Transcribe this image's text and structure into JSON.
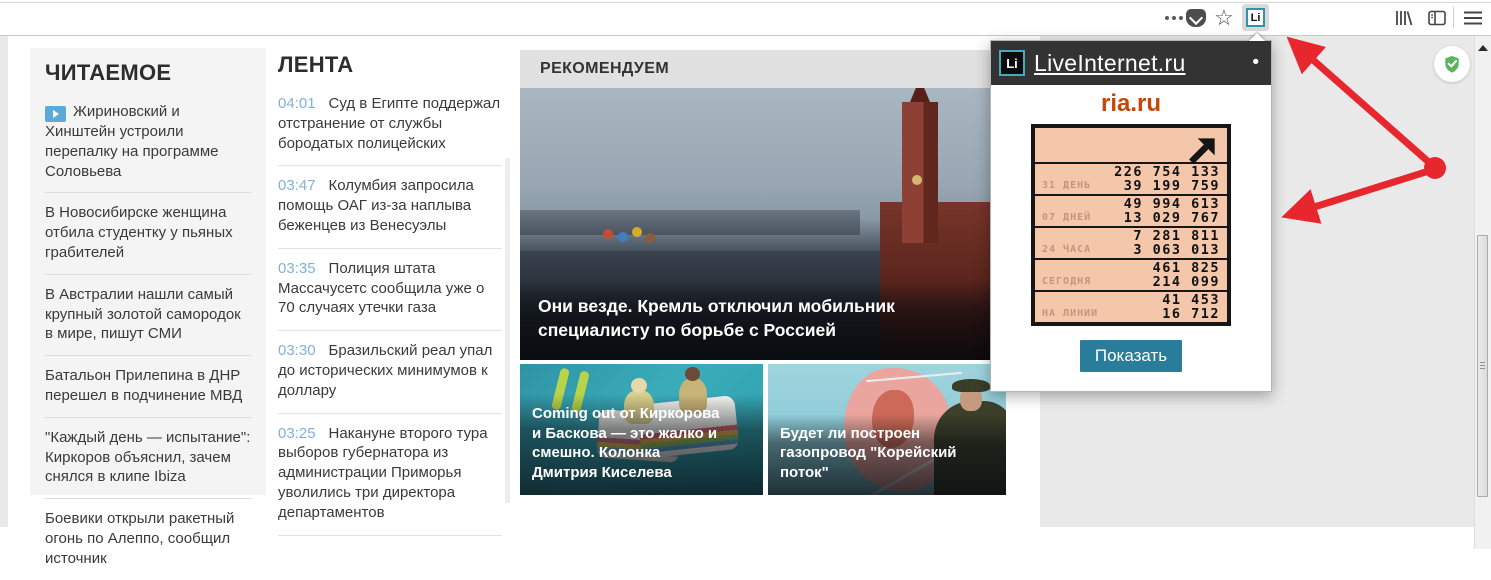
{
  "browser": {
    "li_button": "Li"
  },
  "page": {
    "readable": {
      "title": "ЧИТАЕМОЕ",
      "items": [
        {
          "text": "Жириновский и Хинштейн устроили перепалку на программе Соловьева"
        },
        {
          "text": "В Новосибирске женщина отбила студентку у пьяных грабителей"
        },
        {
          "text": "В Австралии нашли самый крупный золотой самородок в мире, пишут СМИ"
        },
        {
          "text": "Батальон Прилепина в ДНР перешел в подчинение МВД"
        },
        {
          "text": "\"Каждый день — испытание\": Киркоров объяснил, зачем снялся в клипе Ibiza"
        },
        {
          "text": "Боевики открыли ракетный огонь по Алеппо, сообщил источник"
        }
      ]
    },
    "feed": {
      "title": "ЛЕНТА",
      "items": [
        {
          "time": "04:01",
          "text": "Суд в Египте поддержал отстранение от службы бородатых полицейских"
        },
        {
          "time": "03:47",
          "text": "Колумбия запросила помощь ОАГ из-за наплыва беженцев из Венесуэлы"
        },
        {
          "time": "03:35",
          "text": "Полиция штата Массачусетс сообщила уже о 70 случаях утечки газа"
        },
        {
          "time": "03:30",
          "text": "Бразильский реал упал до исторических минимумов к доллару"
        },
        {
          "time": "03:25",
          "text": "Накануне второго тура выборов губернатора из администрации Приморья уволились три директора департаментов"
        }
      ]
    },
    "recommended": {
      "title": "РЕКОМЕНДУЕМ",
      "main_story": "Они везде. Кремль отключил мобильник специалисту по борьбе с Россией",
      "stories": [
        {
          "text": "Coming out от Киркорова и Баскова — это жалко и смешно. Колонка Дмитрия Киселева"
        },
        {
          "text": "Будет ли построен газопровод \"Корейский поток\""
        }
      ]
    }
  },
  "popup": {
    "logo": "Li",
    "brand": "LiveInternet.ru",
    "menu_dot": "•",
    "site": "ria.ru",
    "counter": {
      "rows": [
        {
          "label": "31 ДЕНЬ",
          "views": "226 754 133",
          "visitors": "39 199 759"
        },
        {
          "label": "07 ДНЕЙ",
          "views": "49 994 613",
          "visitors": "13 029 767"
        },
        {
          "label": "24 ЧАСА",
          "views": "7 281 811",
          "visitors": "3 063 013"
        },
        {
          "label": "СЕГОДНЯ",
          "views": "461 825",
          "visitors": "214 099"
        },
        {
          "label": "НА ЛИНИИ",
          "views": "41 453",
          "visitors": "16 712"
        }
      ]
    },
    "show_button": "Показать"
  },
  "colors": {
    "annotation_red": "#e8262d",
    "counter_bg": "#f4c6aa",
    "brand_orange": "#c54708",
    "button_teal": "#2a7c9b"
  }
}
